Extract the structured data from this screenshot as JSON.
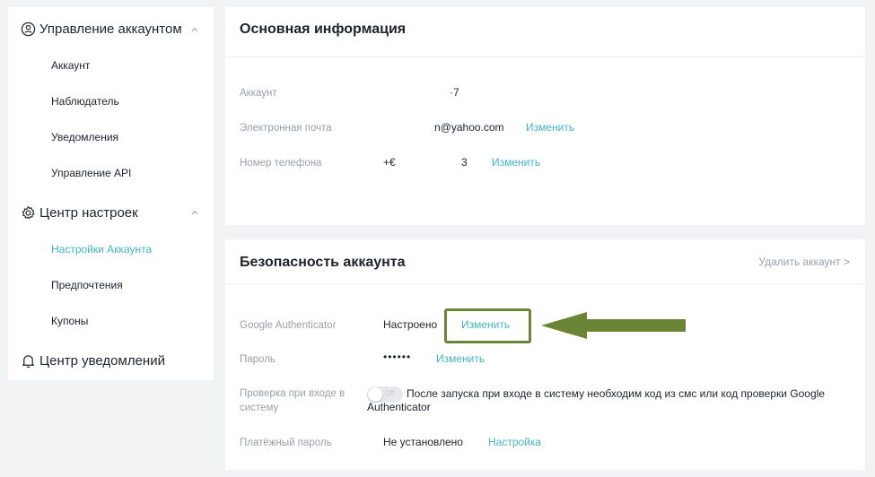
{
  "sidebar": {
    "account_group": {
      "label": "Управление аккаунтом",
      "icon": "user-circle-icon"
    },
    "account_items": [
      "Аккаунт",
      "Наблюдатель",
      "Уведомления",
      "Управление API"
    ],
    "settings_group": {
      "label": "Центр настроек",
      "icon": "gear-icon"
    },
    "settings_items": [
      "Настройки Аккаунта",
      "Предпочтения",
      "Купоны"
    ],
    "notifications_group": {
      "label": "Центр уведомлений",
      "icon": "bell-icon"
    }
  },
  "basic_info": {
    "title": "Основная информация",
    "account_label": "Аккаунт",
    "account_value": "·7",
    "email_label": "Электронная почта",
    "email_value": "n@yahoo.com",
    "email_change": "Изменить",
    "phone_label": "Номер телефона",
    "phone_value_a": "+€",
    "phone_value_b": "3",
    "phone_change": "Изменить"
  },
  "security": {
    "title": "Безопасность аккаунта",
    "delete_account": "Удалить аккаунт >",
    "ga_label": "Google Authenticator",
    "ga_status": "Настроено",
    "ga_change": "Изменить",
    "password_label": "Пароль",
    "password_value": "••••••",
    "password_change": "Изменить",
    "login_check_label": "Проверка при входе в систему",
    "login_check_toggle": "Off",
    "login_check_desc": "После запуска при входе в систему необходим код из смс или код проверки Google Authenticator",
    "trade_pwd_label": "Платёжный пароль",
    "trade_pwd_status": "Не установлено",
    "trade_pwd_action": "Настройка"
  },
  "colors": {
    "accent": "#43b5c3",
    "arrow": "#6c8436",
    "text": "#1e2329",
    "muted": "#9aa0a6"
  }
}
